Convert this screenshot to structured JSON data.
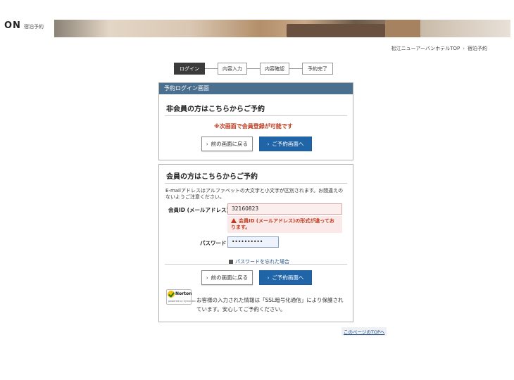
{
  "header": {
    "logo_text": "ON",
    "logo_sub": "宿泊予約"
  },
  "breadcrumb": {
    "home": "松江ニューアーバンホテルTOP",
    "separator": "›",
    "current": "宿泊予約"
  },
  "steps": [
    {
      "label": "ログイン",
      "active": true
    },
    {
      "label": "内容入力",
      "active": false
    },
    {
      "label": "内容確認",
      "active": false
    },
    {
      "label": "予約完了",
      "active": false
    }
  ],
  "panel_title": "予約ログイン画面",
  "guest": {
    "title": "非会員の方はこちらからご予約",
    "notice": "※次画面で会員登録が可能です",
    "back_label": "前の画面に戻る",
    "go_label": "ご予約画面へ"
  },
  "member": {
    "title": "会員の方はこちらからご予約",
    "description": "E-mailアドレスはアルファベットの大文字と小文字が区別されます。お間違えのないようご注意ください。",
    "id_label": "会員ID (メールアドレス)",
    "id_value": "32160823",
    "id_error": "会員ID (メールアドレス)の形式が違っております。",
    "password_label": "パスワード",
    "password_value": "••••••••••",
    "forgot_link": "パスワードを忘れた場合",
    "back_label": "前の画面に戻る",
    "go_label": "ご予約画面へ"
  },
  "norton": {
    "brand": "Norton",
    "sub": "powered by Symantec",
    "message": "お客様の入力された情報は「SSL暗号化通信」により保護されています。安心してご予約ください。"
  },
  "page_top_link": "このページのTOPへ",
  "colors": {
    "panel_header": "#4b6f8f",
    "primary_button": "#1f65a8",
    "error_red": "#c0391b",
    "active_step": "#3b3b3b"
  }
}
